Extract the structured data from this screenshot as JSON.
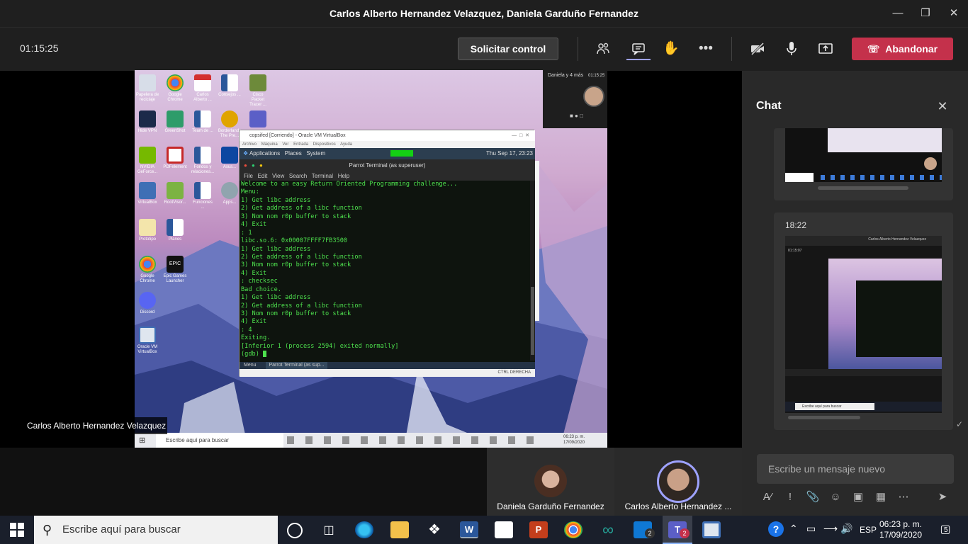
{
  "window": {
    "title": "Carlos Alberto Hernandez Velazquez, Daniela Garduño Fernandez"
  },
  "meeting": {
    "duration": "01:15:25",
    "request_control": "Solicitar control",
    "leave": "Abandonar",
    "icons": [
      "participants-icon",
      "chat-icon",
      "raise-hand-icon",
      "more-options-icon",
      "camera-off-icon",
      "microphone-icon",
      "share-screen-icon"
    ]
  },
  "remote": {
    "vm_title": "copsifed [Corriendo] - Oracle VM VirtualBox",
    "vm_menu": [
      "Archivo",
      "Máquina",
      "Ver",
      "Entrada",
      "Dispositivos",
      "Ayuda"
    ],
    "parrot_bar": {
      "apps": "Applications",
      "places": "Places",
      "system": "System",
      "clock": "Thu Sep 17, 23:23"
    },
    "terminal_title": "Parrot Terminal (as superuser)",
    "terminal_menu": [
      "File",
      "Edit",
      "View",
      "Search",
      "Terminal",
      "Help"
    ],
    "terminal_lines": [
      "Welcome to an easy Return Oriented Programming challenge...",
      "Menu:",
      "1) Get libc address",
      "2) Get address of a libc function",
      "3) Nom nom r0p buffer to stack",
      "4) Exit",
      ": 1",
      "libc.so.6: 0x00007FFFF7FB3500",
      "1) Get libc address",
      "2) Get address of a libc function",
      "3) Nom nom r0p buffer to stack",
      "4) Exit",
      ": checksec",
      "Bad choice.",
      "1) Get libc address",
      "2) Get address of a libc function",
      "3) Nom nom r0p buffer to stack",
      "4) Exit",
      ": 4",
      "Exiting.",
      "[Inferior 1 (process 2594) exited normally]",
      "(gdb) "
    ],
    "vm_taskbar": {
      "menu": "Menu",
      "task": "Parrot Terminal (as sup..."
    },
    "vm_status": "CTRL DERECHA",
    "thumb_label": "Daniela y 4 más",
    "thumb_time": "01:15:25",
    "taskbar_search": "Escribe aquí para buscar",
    "taskbar_clock": "06:23 p. m.",
    "taskbar_date": "17/09/2020",
    "desktop_icons": [
      "Papelera de reciclaje",
      "Google Chrome",
      "Carlos Alberto ...",
      "Consejos ...",
      "Cisco Packet Tracer ...",
      "Hide VPN",
      "GreenShot",
      "Team de ...",
      "Borderlands The Pre...",
      "NVIDIA GeForce...",
      "PDFelement",
      "Fondos y relaciones...",
      "Asus...",
      "VirtualBox",
      "RootVisor...",
      "Funciones ...",
      "Apps...",
      "Prototipo",
      "Planes",
      "Google Chrome",
      "Epic Games Launcher",
      "Discord",
      "Oracle VM VirtualBox"
    ],
    "presenter_name": "Carlos Alberto Hernandez Velazquez"
  },
  "participants": [
    {
      "name": "Daniela Garduño Fernandez"
    },
    {
      "name": "Carlos Alberto Hernandez ..."
    }
  ],
  "chat": {
    "title": "Chat",
    "message_time": "18:22",
    "input_placeholder": "Escribe un mensaje nuevo",
    "thumb_header": "Carlos Alberto Hernandez Velazquez",
    "thumb_timer": "01:15:07",
    "thumb_search": "Escribe aquí para buscar",
    "toolbar_icons": [
      "format-icon",
      "important-icon",
      "attach-icon",
      "emoji-icon",
      "sticker-icon",
      "schedule-icon",
      "more-icon",
      "send-icon"
    ]
  },
  "taskbar": {
    "search_placeholder": "Escribe aquí para buscar",
    "lang": "ESP",
    "time": "06:23 p. m.",
    "date": "17/09/2020",
    "notifications": "5",
    "mail_badge": "2",
    "teams_badge": "2"
  },
  "colors": {
    "leave": "#c4314b",
    "terminal_text": "#4ee24e",
    "teams_accent": "#6264a7"
  }
}
